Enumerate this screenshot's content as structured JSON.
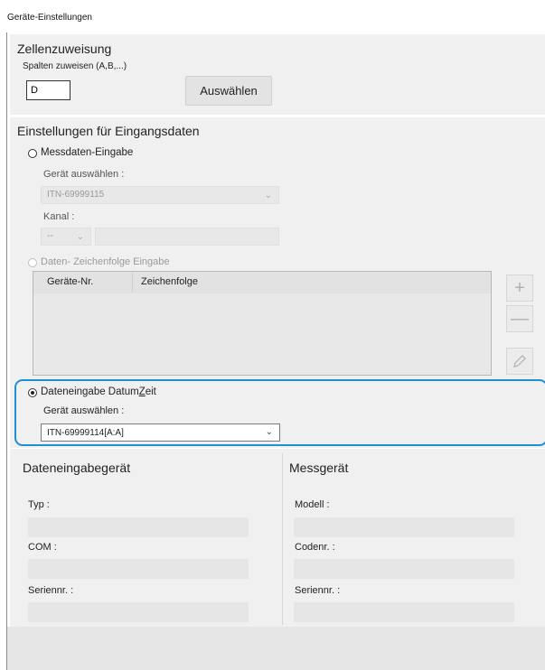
{
  "window": {
    "title": "Geräte-Einstellungen"
  },
  "cell_assignment": {
    "heading": "Zellenzuweisung",
    "columns_label": "Spalten zuweisen (A,B,...)",
    "column_value": "D",
    "select_button": "Auswählen"
  },
  "input_settings": {
    "heading": "Einstellungen für Eingangsdaten",
    "measure_input": {
      "label": "Messdaten-Eingabe",
      "device_label": "Gerät auswählen :",
      "device_value": "ITN-69999115",
      "channel_label": "Kanal :",
      "channel_value": "--"
    },
    "string_input": {
      "label": "Daten- Zeichenfolge Eingabe",
      "columns": [
        "Geräte-Nr.",
        "Zeichenfolge"
      ],
      "add_icon": "plus-icon",
      "remove_icon": "minus-icon",
      "edit_icon": "pencil-icon"
    },
    "datetime_input": {
      "label_pre": "Dateneingabe Datum",
      "label_underlined": "Z",
      "label_post": "eit",
      "device_label": "Gerät auswählen :",
      "device_value": "ITN-69999114[A:A]"
    }
  },
  "data_input_device": {
    "heading": "Dateneingabegerät",
    "type_label": "Typ :",
    "com_label": "COM :",
    "serial_label": "Seriennr. :"
  },
  "measuring_device": {
    "heading": "Messgerät",
    "model_label": "Modell :",
    "code_label": "Codenr. :",
    "serial_label": "Seriennr. :"
  },
  "colors": {
    "highlight": "#1e90d6",
    "panel": "#f0f0f0"
  }
}
